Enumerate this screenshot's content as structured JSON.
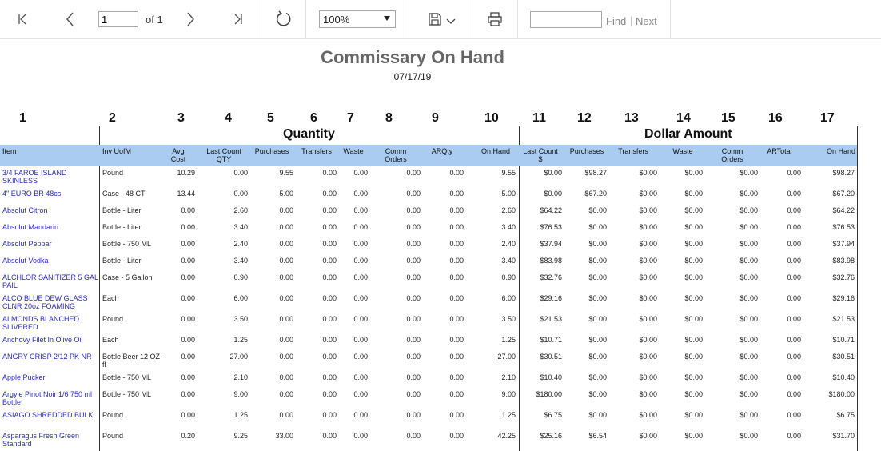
{
  "toolbar": {
    "page_value": "1",
    "of_label": "of 1",
    "zoom_value": "100%",
    "find_placeholder": "",
    "find_label": "Find",
    "next_label": "Next",
    "separator": "|"
  },
  "report": {
    "title": "Commissary On Hand",
    "date": "07/17/19",
    "column_numbers": [
      "1",
      "2",
      "3",
      "4",
      "5",
      "6",
      "7",
      "8",
      "9",
      "10",
      "11",
      "12",
      "13",
      "14",
      "15",
      "16",
      "17"
    ],
    "group_quantity": "Quantity",
    "group_dollar": "Dollar Amount",
    "headers": [
      "Item",
      "Inv UofM",
      "Avg Cost",
      "Last Count QTY",
      "Purchases",
      "Transfers",
      "Waste",
      "Comm Orders",
      "ARQty",
      "On Hand",
      "Last Count $",
      "Purchases",
      "Transfers",
      "Waste",
      "Comm Orders",
      "ARTotal",
      "On Hand"
    ],
    "rows": [
      {
        "item": "3/4 FAROE ISLAND SKINLESS",
        "uofm": "Pound",
        "v": [
          "10.29",
          "0.00",
          "9.55",
          "0.00",
          "0.00",
          "0.00",
          "0.00",
          "9.55",
          "$0.00",
          "$98.27",
          "$0.00",
          "$0.00",
          "$0.00",
          "0.00",
          "$98.27"
        ]
      },
      {
        "item": "4\" EURO BR 48cs",
        "uofm": "Case - 48 CT",
        "v": [
          "13.44",
          "0.00",
          "5.00",
          "0.00",
          "0.00",
          "0.00",
          "0.00",
          "5.00",
          "$0.00",
          "$67.20",
          "$0.00",
          "$0.00",
          "$0.00",
          "0.00",
          "$67.20"
        ]
      },
      {
        "item": "Absolut Citron",
        "uofm": "Bottle - Liter",
        "v": [
          "0.00",
          "2.60",
          "0.00",
          "0.00",
          "0.00",
          "0.00",
          "0.00",
          "2.60",
          "$64.22",
          "$0.00",
          "$0.00",
          "$0.00",
          "$0.00",
          "0.00",
          "$64.22"
        ]
      },
      {
        "item": "Absolut Mandarin",
        "uofm": "Bottle - Liter",
        "v": [
          "0.00",
          "3.40",
          "0.00",
          "0.00",
          "0.00",
          "0.00",
          "0.00",
          "3.40",
          "$76.53",
          "$0.00",
          "$0.00",
          "$0.00",
          "$0.00",
          "0.00",
          "$76.53"
        ]
      },
      {
        "item": "Absolut Peppar",
        "uofm": "Bottle - 750 ML",
        "v": [
          "0.00",
          "2.40",
          "0.00",
          "0.00",
          "0.00",
          "0.00",
          "0.00",
          "2.40",
          "$37.94",
          "$0.00",
          "$0.00",
          "$0.00",
          "$0.00",
          "0.00",
          "$37.94"
        ]
      },
      {
        "item": "Absolut Vodka",
        "uofm": "Bottle - Liter",
        "v": [
          "0.00",
          "3.40",
          "0.00",
          "0.00",
          "0.00",
          "0.00",
          "0.00",
          "3.40",
          "$83.98",
          "$0.00",
          "$0.00",
          "$0.00",
          "$0.00",
          "0.00",
          "$83.98"
        ]
      },
      {
        "item": "ALCHLOR SANITIZER 5 GAL PAIL",
        "uofm": "Case - 5 Gallon",
        "v": [
          "0.00",
          "0.90",
          "0.00",
          "0.00",
          "0.00",
          "0.00",
          "0.00",
          "0.90",
          "$32.76",
          "$0.00",
          "$0.00",
          "$0.00",
          "$0.00",
          "0.00",
          "$32.76"
        ]
      },
      {
        "item": "ALCO BLUE DEW GLASS CLNR 20oz FOAMING",
        "uofm": "Each",
        "v": [
          "0.00",
          "6.00",
          "0.00",
          "0.00",
          "0.00",
          "0.00",
          "0.00",
          "6.00",
          "$29.16",
          "$0.00",
          "$0.00",
          "$0.00",
          "$0.00",
          "0.00",
          "$29.16"
        ]
      },
      {
        "item": "ALMONDS BLANCHED SLIVERED",
        "uofm": "Pound",
        "v": [
          "0.00",
          "3.50",
          "0.00",
          "0.00",
          "0.00",
          "0.00",
          "0.00",
          "3.50",
          "$21.53",
          "$0.00",
          "$0.00",
          "$0.00",
          "$0.00",
          "0.00",
          "$21.53"
        ]
      },
      {
        "item": "Anchovy Filet In Olive Oil",
        "uofm": "Each",
        "v": [
          "0.00",
          "1.25",
          "0.00",
          "0.00",
          "0.00",
          "0.00",
          "0.00",
          "1.25",
          "$10.71",
          "$0.00",
          "$0.00",
          "$0.00",
          "$0.00",
          "0.00",
          "$10.71"
        ]
      },
      {
        "item": "ANGRY CRISP 2/12 PK NR",
        "uofm": "Bottle Beer 12 OZ-fl",
        "v": [
          "0.00",
          "27.00",
          "0.00",
          "0.00",
          "0.00",
          "0.00",
          "0.00",
          "27.00",
          "$30.51",
          "$0.00",
          "$0.00",
          "$0.00",
          "$0.00",
          "0.00",
          "$30.51"
        ]
      },
      {
        "item": "Apple Pucker",
        "uofm": "Bottle - 750 ML",
        "v": [
          "0.00",
          "2.10",
          "0.00",
          "0.00",
          "0.00",
          "0.00",
          "0.00",
          "2.10",
          "$10.40",
          "$0.00",
          "$0.00",
          "$0.00",
          "$0.00",
          "0.00",
          "$10.40"
        ]
      },
      {
        "item": "Argyle Pinot Noir 1/6 750 ml Bottle",
        "uofm": "Bottle - 750 ML",
        "v": [
          "0.00",
          "9.00",
          "0.00",
          "0.00",
          "0.00",
          "0.00",
          "0.00",
          "9.00",
          "$180.00",
          "$0.00",
          "$0.00",
          "$0.00",
          "$0.00",
          "0.00",
          "$180.00"
        ]
      },
      {
        "item": "ASIAGO SHREDDED BULK",
        "uofm": "Pound",
        "v": [
          "0.00",
          "1.25",
          "0.00",
          "0.00",
          "0.00",
          "0.00",
          "0.00",
          "1.25",
          "$6.75",
          "$0.00",
          "$0.00",
          "$0.00",
          "$0.00",
          "0.00",
          "$6.75"
        ]
      },
      {
        "item": "Asparagus Fresh Green Standard",
        "uofm": "Pound",
        "v": [
          "0.20",
          "9.25",
          "33.00",
          "0.00",
          "0.00",
          "0.00",
          "0.00",
          "42.25",
          "$25.16",
          "$6.54",
          "$0.00",
          "$0.00",
          "$0.00",
          "0.00",
          "$31.70"
        ]
      }
    ]
  }
}
